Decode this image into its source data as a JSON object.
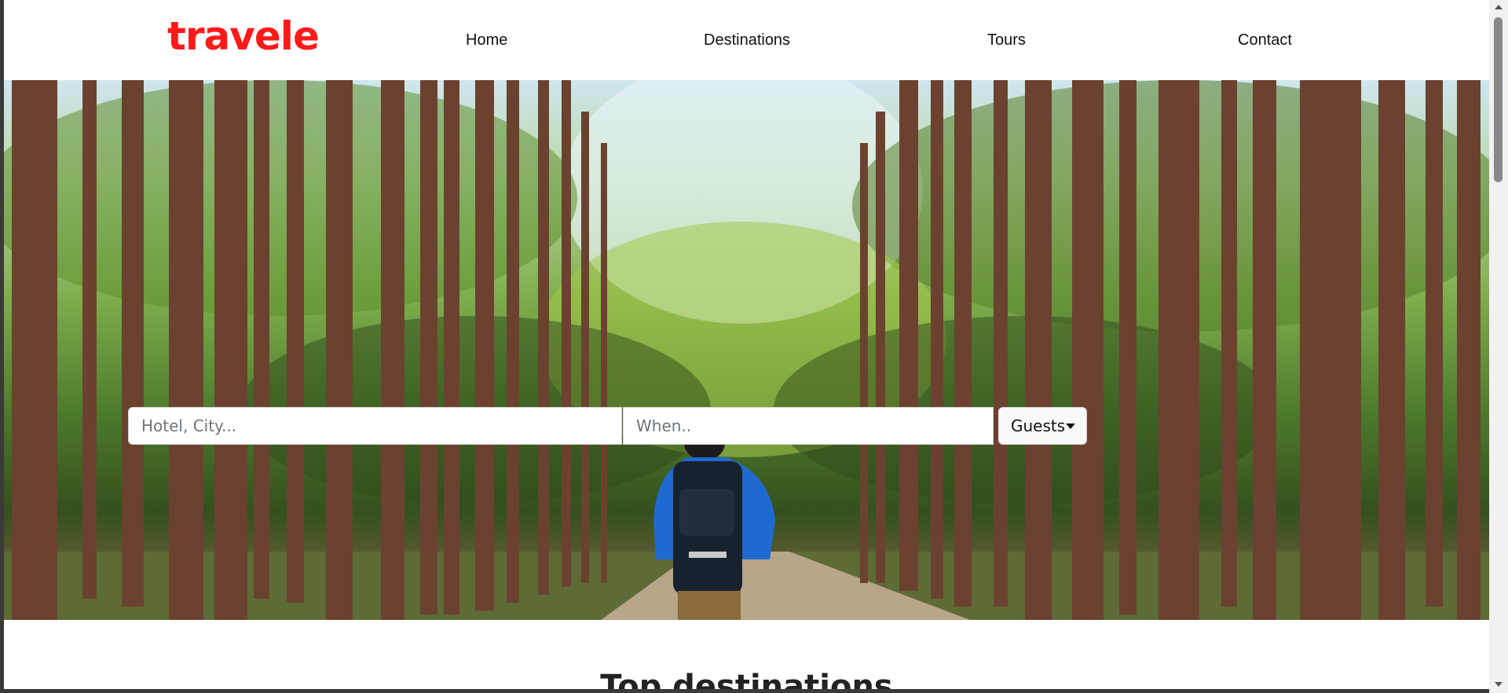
{
  "header": {
    "logo": "travele",
    "nav": {
      "home": "Home",
      "destinations": "Destinations",
      "tours": "Tours",
      "contact": "Contact"
    }
  },
  "hero": {
    "image": "forest-hiker-photo",
    "search": {
      "where_placeholder": "Hotel, City...",
      "when_placeholder": "When..",
      "guests_label": "Guests"
    }
  },
  "section": {
    "title": "Top destinations"
  },
  "colors": {
    "brand": "#ff1a1a",
    "text": "#111111",
    "placeholder": "#6c757d"
  },
  "icons": {
    "guests_dropdown": "caret-down-icon"
  }
}
